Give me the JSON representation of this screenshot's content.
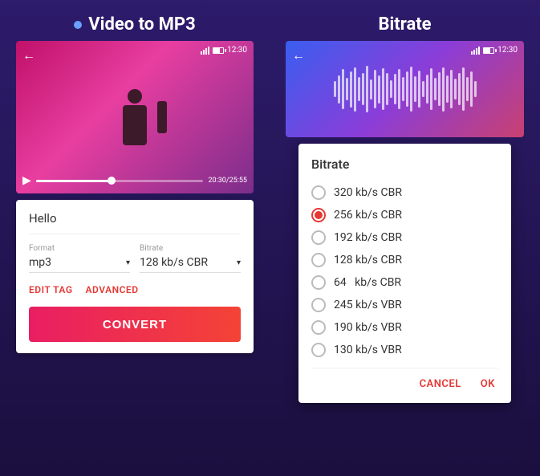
{
  "left": {
    "title": "Video to MP3",
    "status_bar": {
      "time": "12:30"
    },
    "video": {
      "time_elapsed": "20:30",
      "time_total": "25:55",
      "time_display": "20:30/25:55"
    },
    "card": {
      "filename": "Hello",
      "format_label": "Format",
      "format_value": "mp3",
      "bitrate_label": "Bitrate",
      "bitrate_value": "128 kb/s CBR",
      "edit_tag_label": "EDIT TAG",
      "advanced_label": "ADVANCED",
      "convert_label": "CONVERT"
    }
  },
  "right": {
    "title": "Bitrate",
    "status_bar": {
      "time": "12:30"
    },
    "dialog": {
      "title": "Bitrate",
      "options": [
        {
          "label": "320 kb/s CBR",
          "selected": false
        },
        {
          "label": "256 kb/s CBR",
          "selected": true
        },
        {
          "label": "192 kb/s CBR",
          "selected": false
        },
        {
          "label": "128 kb/s CBR",
          "selected": false
        },
        {
          "label": "64   kb/s CBR",
          "selected": false
        },
        {
          "label": "245 kb/s VBR",
          "selected": false
        },
        {
          "label": "190 kb/s VBR",
          "selected": false
        },
        {
          "label": "130 kb/s VBR",
          "selected": false
        }
      ],
      "cancel_label": "CANCEL",
      "ok_label": "OK"
    }
  }
}
